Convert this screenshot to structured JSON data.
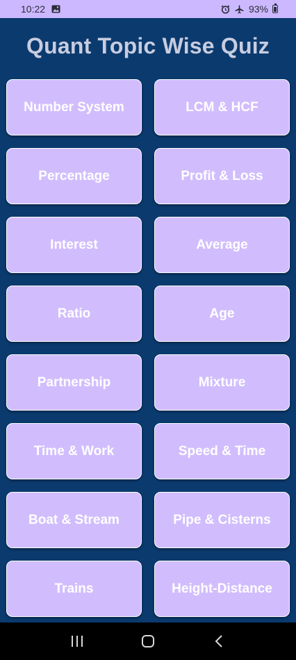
{
  "status_bar": {
    "time": "10:22",
    "battery": "93%",
    "icons": [
      "image-icon",
      "alarm-icon",
      "airplane-icon",
      "battery-icon"
    ]
  },
  "app": {
    "title": "Quant Topic Wise Quiz"
  },
  "topics": [
    {
      "label": "Number System"
    },
    {
      "label": "LCM & HCF"
    },
    {
      "label": "Percentage"
    },
    {
      "label": "Profit & Loss"
    },
    {
      "label": "Interest"
    },
    {
      "label": "Average"
    },
    {
      "label": "Ratio"
    },
    {
      "label": "Age"
    },
    {
      "label": "Partnership"
    },
    {
      "label": "Mixture"
    },
    {
      "label": "Time & Work"
    },
    {
      "label": "Speed & Time"
    },
    {
      "label": "Boat & Stream"
    },
    {
      "label": "Pipe & Cisterns"
    },
    {
      "label": "Trains"
    },
    {
      "label": "Height-Distance"
    }
  ],
  "colors": {
    "background": "#0b3a6e",
    "button": "#d1bdfd",
    "status_bar": "#cbb8ff",
    "title_text": "#c8cde0"
  },
  "nav_bar": {
    "buttons": [
      "recent-apps-icon",
      "home-icon",
      "back-icon"
    ]
  }
}
